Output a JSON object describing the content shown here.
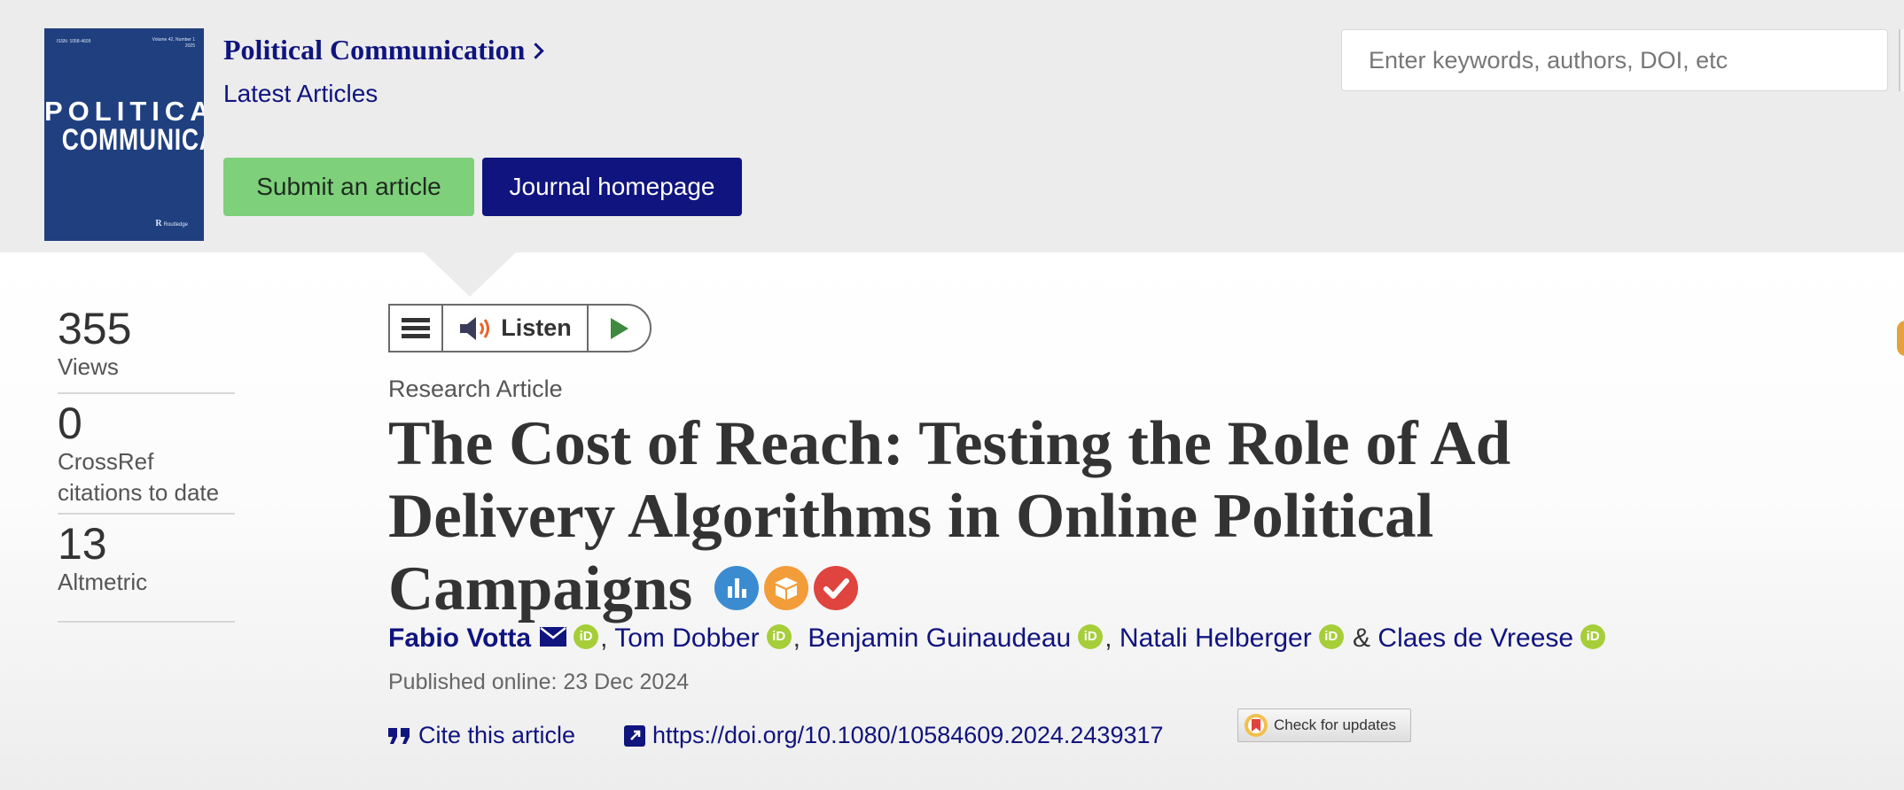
{
  "header": {
    "cover": {
      "issn": "ISSN: 1058-4609",
      "volume": "Volume 42, Number 1",
      "year": "2025",
      "title_line1": "POLITICAL",
      "title_line2": "COMMUNICATION",
      "publisher": "Routledge"
    },
    "journal_name": "Political Communication",
    "section": "Latest Articles",
    "submit_label": "Submit an article",
    "homepage_label": "Journal homepage",
    "search_placeholder": "Enter keywords, authors, DOI, etc"
  },
  "metrics": [
    {
      "value": "355",
      "label": "Views"
    },
    {
      "value": "0",
      "label": "CrossRef citations to date"
    },
    {
      "value": "13",
      "label": "Altmetric"
    }
  ],
  "listen_widget": {
    "label": "Listen"
  },
  "article": {
    "type": "Research Article",
    "title": "The Cost of Reach: Testing the Role of Ad Delivery Algorithms in Online Political Campaigns",
    "badges": [
      "open-data-badge",
      "open-materials-badge",
      "preregistered-badge"
    ],
    "badge_colors": [
      "#3b8bd0",
      "#f39c3a",
      "#e0443e"
    ],
    "authors": [
      {
        "name": "Fabio Votta",
        "separator": ","
      },
      {
        "name": "Tom Dobber",
        "separator": ","
      },
      {
        "name": "Benjamin Guinaudeau",
        "separator": ","
      },
      {
        "name": "Natali Helberger",
        "separator": " &"
      },
      {
        "name": "Claes de Vreese",
        "separator": ""
      }
    ],
    "orcid_label": "iD",
    "published": "Published online: 23 Dec 2024",
    "cite_label": "Cite this article",
    "doi": "https://doi.org/10.1080/10584609.2024.2439317",
    "check_updates_label": "Check for updates"
  },
  "colors": {
    "brand": "#10147e",
    "submit": "#7ed07b",
    "orcid": "#a6ce39"
  }
}
